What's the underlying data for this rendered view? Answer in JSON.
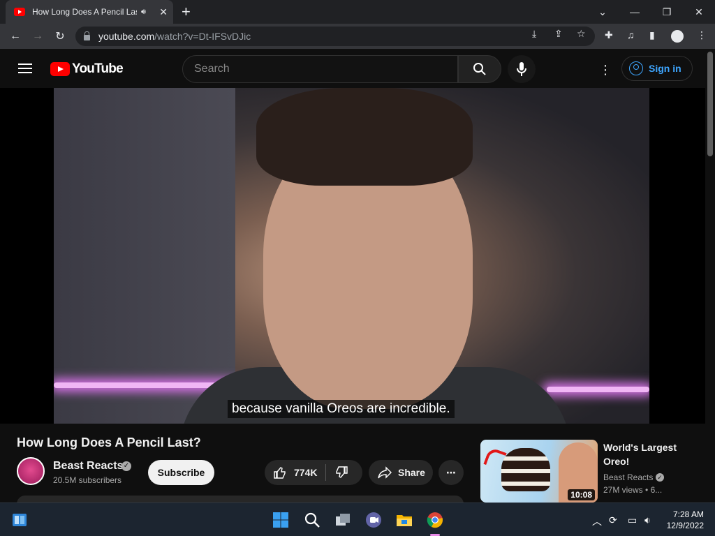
{
  "browser": {
    "tab": {
      "title": "How Long Does A Pencil Last?",
      "audio_icon": "speaker-icon"
    },
    "new_tab": "+",
    "window": {
      "minimize": "—",
      "restore": "❐",
      "close": "✕",
      "tablist": "⌄"
    },
    "address": {
      "host": "youtube.com",
      "path": "/watch?v=Dt-IFSvDJic"
    }
  },
  "youtube": {
    "logo_text": "YouTube",
    "search_placeholder": "Search",
    "sign_in": "Sign in",
    "caption": "because vanilla Oreos are incredible.",
    "video": {
      "title": "How Long Does A Pencil Last?",
      "channel": "Beast Reacts",
      "subscribers": "20.5M subscribers",
      "subscribe_label": "Subscribe",
      "likes": "774K",
      "share_label": "Share"
    },
    "recommended": {
      "title": "World's Largest Oreo!",
      "channel": "Beast Reacts",
      "views": "27M views",
      "age_truncated": "6...",
      "duration": "10:08"
    }
  },
  "taskbar": {
    "time": "7:28 AM",
    "date": "12/9/2022"
  }
}
